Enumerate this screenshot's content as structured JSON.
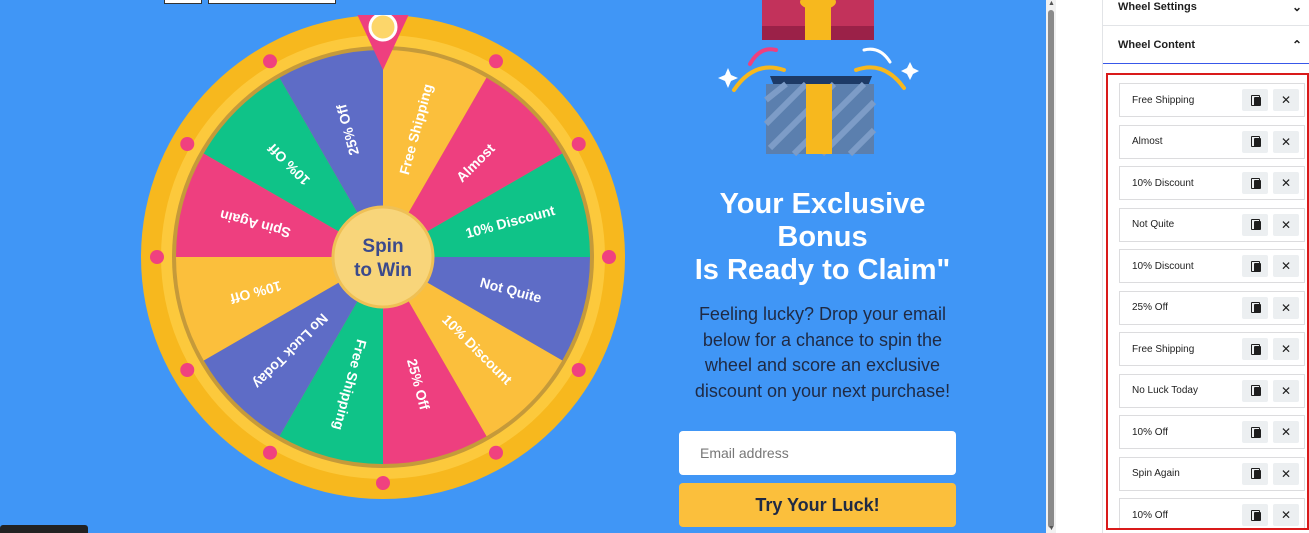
{
  "wheel": {
    "center_label": [
      "Spin",
      "to Win"
    ],
    "segments": [
      {
        "label": "Free Shipping",
        "color": "#fbbf3c"
      },
      {
        "label": "Almost",
        "color": "#ee3f7f"
      },
      {
        "label": "10% Discount",
        "color": "#0fc388"
      },
      {
        "label": "Not Quite",
        "color": "#5e6cc6"
      },
      {
        "label": "10% Discount",
        "color": "#fbbf3c"
      },
      {
        "label": "25% Off",
        "color": "#ee3f7f"
      },
      {
        "label": "Free Shipping",
        "color": "#0fc388"
      },
      {
        "label": "No Luck Today",
        "color": "#5e6cc6"
      },
      {
        "label": "10% Off",
        "color": "#fbbf3c"
      },
      {
        "label": "Spin Again",
        "color": "#ee3f7f"
      },
      {
        "label": "10% Off",
        "color": "#0fc388"
      },
      {
        "label": "25% Off",
        "color": "#5e6cc6"
      }
    ]
  },
  "offer": {
    "headline_lines": [
      "Your Exclusive",
      "Bonus",
      "Is Ready to Claim\""
    ],
    "description": "Feeling lucky? Drop your email below for a chance to spin the wheel and score an exclusive discount on your next purchase!",
    "email_placeholder": "Email address",
    "cta_label": "Try Your Luck!"
  },
  "panel": {
    "sections": [
      {
        "label": "Wheel Settings",
        "chevron": "⌄",
        "expanded": false
      },
      {
        "label": "Wheel Content",
        "chevron": "⌃",
        "expanded": true
      }
    ],
    "items": [
      "Free Shipping",
      "Almost",
      "10% Discount",
      "Not Quite",
      "10% Discount",
      "25% Off",
      "Free Shipping",
      "No Luck Today",
      "10% Off",
      "Spin Again",
      "10% Off"
    ],
    "remove_glyph": "✕"
  },
  "colors": {
    "canvas_bg": "#4096f6",
    "rim": "#f7b81e",
    "cta": "#fbbf3c",
    "highlight_frame": "#d91a1a"
  }
}
